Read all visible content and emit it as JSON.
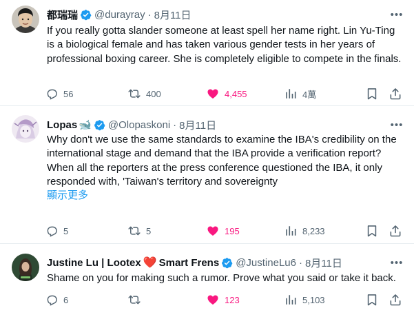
{
  "tweets": [
    {
      "author": "都瑞瑞",
      "handle": "@durayray",
      "date": "8月11日",
      "separator": "·",
      "text": "If you really gotta slander someone at least spell her name right. Lin Yu-Ting is a biological female and has taken various gender tests in her years of professional boxing career. She is completely eligible to compete in the finals.",
      "replies": "56",
      "retweets": "400",
      "likes": "4,455",
      "views": "4萬",
      "liked": true
    },
    {
      "author": "Lopas",
      "author_emoji": "🐋",
      "handle": "@Olopaskoni",
      "date": "8月11日",
      "separator": "·",
      "text_line1": "Why don't we use the same standards to examine the IBA's credibility on the international stage and demand that the IBA provide a verification report?",
      "text_line2": "When all the reporters at the press conference questioned the IBA, it only responded with, 'Taiwan's territory and sovereignty",
      "show_more": "顯示更多",
      "replies": "5",
      "retweets": "5",
      "likes": "195",
      "views": "8,233",
      "liked": true
    },
    {
      "author_part1": "Justine Lu | Lootex",
      "author_heart": "❤️",
      "author_part2": "Smart Frens",
      "handle": "@JustineLu6",
      "date": "8月11日",
      "separator": "·",
      "text": "Shame on you for making such a rumor. Prove what you said or take it back.",
      "replies": "6",
      "retweets": "",
      "likes": "123",
      "views": "5,103",
      "liked": true
    }
  ],
  "colors": {
    "accent": "#1d9bf0",
    "like": "#f91880",
    "muted": "#536471",
    "text": "#0f1419",
    "divider": "#e6ecf0"
  },
  "icons": [
    "reply-icon",
    "retweet-icon",
    "heart-icon",
    "views-icon",
    "bookmark-icon",
    "share-icon",
    "verified-icon",
    "more-icon"
  ]
}
